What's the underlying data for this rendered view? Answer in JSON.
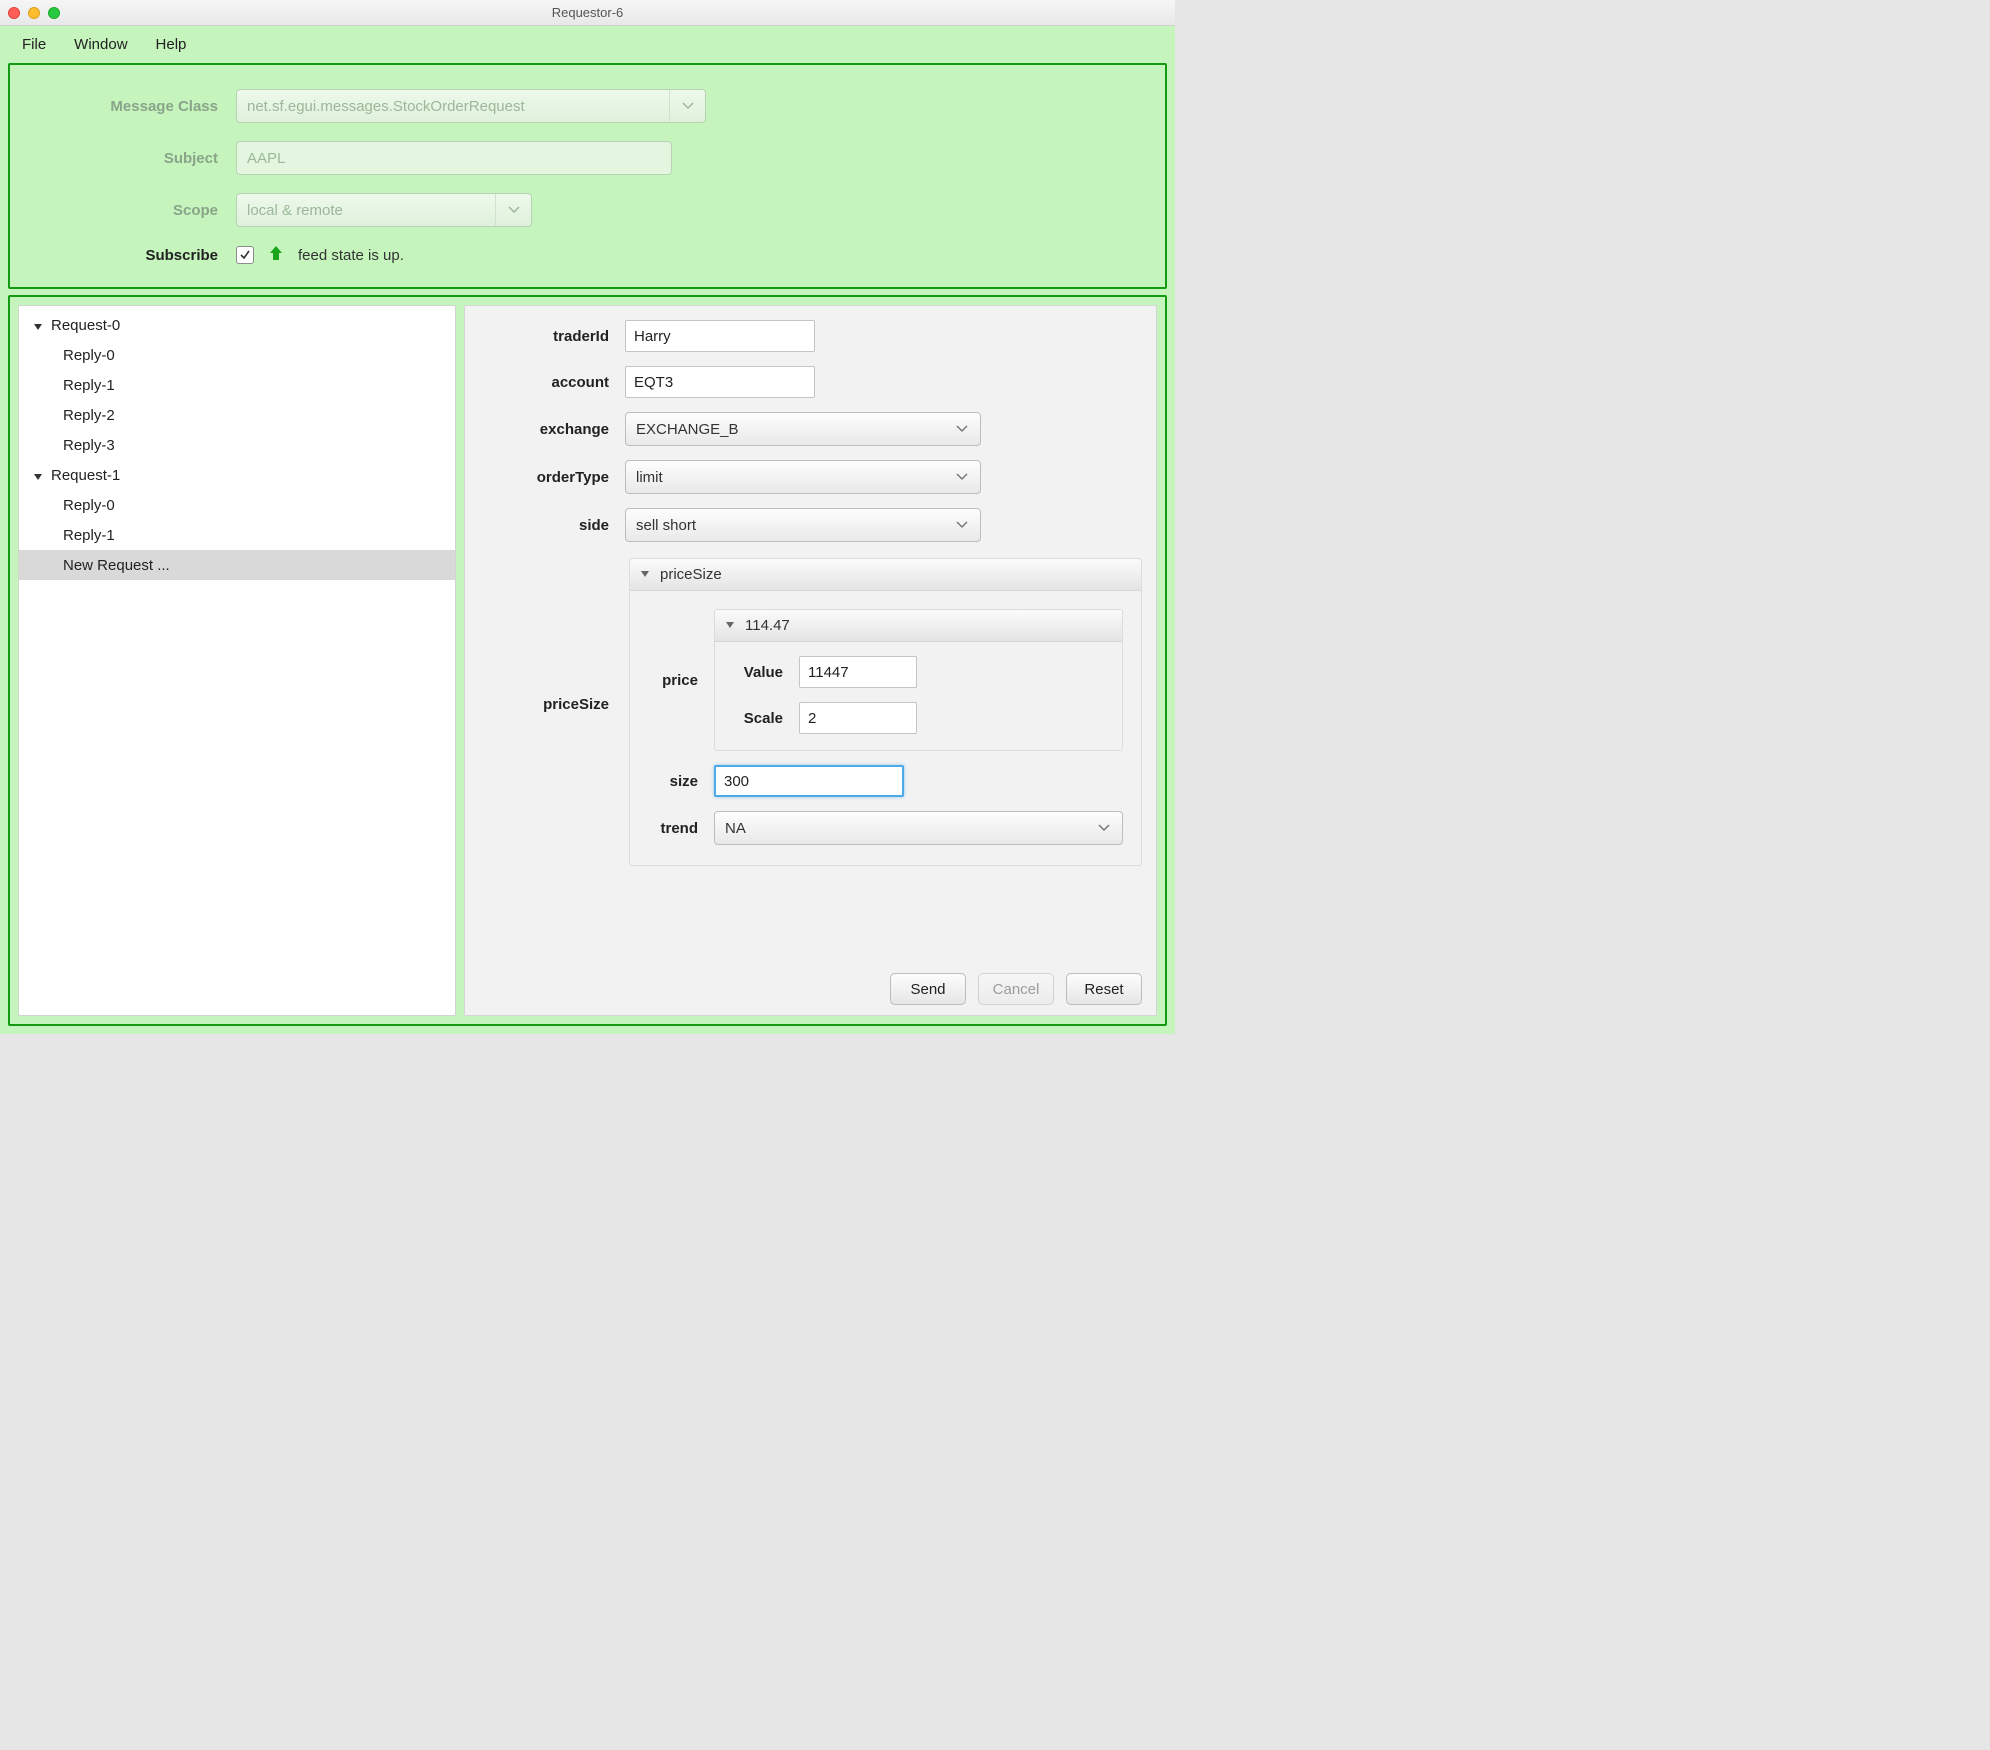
{
  "window": {
    "title": "Requestor-6"
  },
  "menu": {
    "file": "File",
    "window": "Window",
    "help": "Help"
  },
  "top": {
    "messageClass": {
      "label": "Message Class",
      "value": "net.sf.egui.messages.StockOrderRequest"
    },
    "subject": {
      "label": "Subject",
      "value": "AAPL"
    },
    "scope": {
      "label": "Scope",
      "value": "local & remote"
    },
    "subscribe": {
      "label": "Subscribe",
      "checked": true,
      "status": "feed state is up."
    }
  },
  "tree": {
    "items": [
      {
        "label": "Request-0",
        "expandable": true,
        "level": 0
      },
      {
        "label": "Reply-0",
        "expandable": false,
        "level": 1
      },
      {
        "label": "Reply-1",
        "expandable": false,
        "level": 1
      },
      {
        "label": "Reply-2",
        "expandable": false,
        "level": 1
      },
      {
        "label": "Reply-3",
        "expandable": false,
        "level": 1
      },
      {
        "label": "Request-1",
        "expandable": true,
        "level": 0
      },
      {
        "label": "Reply-0",
        "expandable": false,
        "level": 1
      },
      {
        "label": "Reply-1",
        "expandable": false,
        "level": 1
      },
      {
        "label": "New Request ...",
        "expandable": false,
        "level": 1,
        "selected": true
      }
    ]
  },
  "detail": {
    "traderId": {
      "label": "traderId",
      "value": "Harry"
    },
    "account": {
      "label": "account",
      "value": "EQT3"
    },
    "exchange": {
      "label": "exchange",
      "value": "EXCHANGE_B"
    },
    "orderType": {
      "label": "orderType",
      "value": "limit"
    },
    "side": {
      "label": "side",
      "value": "sell short"
    },
    "priceSize": {
      "label": "priceSize",
      "header": "priceSize",
      "price": {
        "label": "price",
        "header": "114.47",
        "valueLabel": "Value",
        "value": "11447",
        "scaleLabel": "Scale",
        "scale": "2"
      },
      "size": {
        "label": "size",
        "value": "300"
      },
      "trend": {
        "label": "trend",
        "value": "NA"
      }
    }
  },
  "buttons": {
    "send": "Send",
    "cancel": "Cancel",
    "reset": "Reset"
  }
}
